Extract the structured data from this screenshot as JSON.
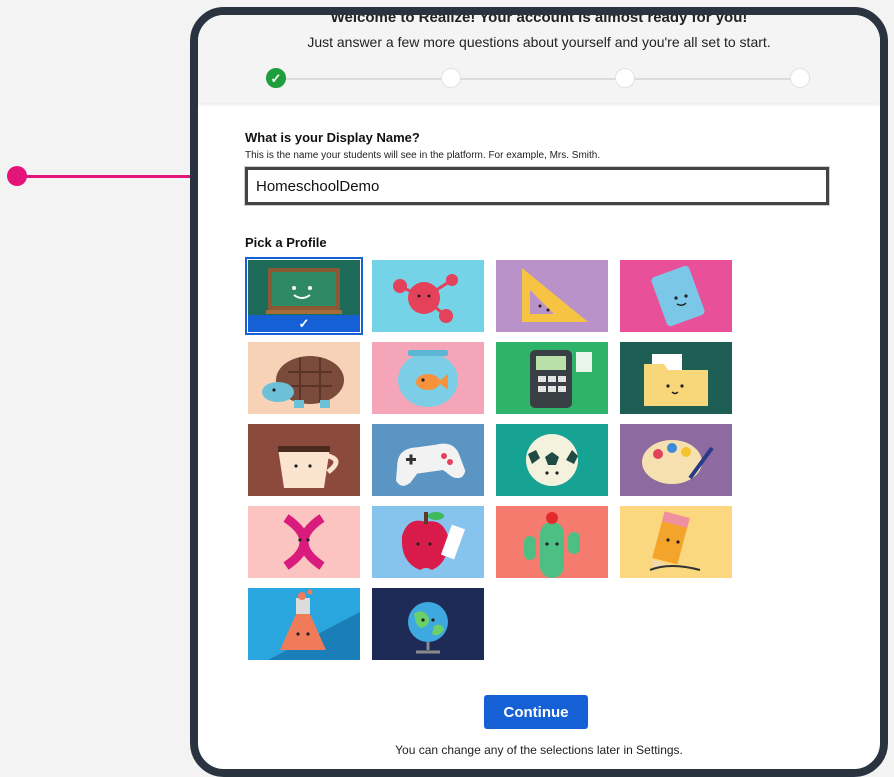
{
  "header": {
    "title": "Welcome to Realize! Your account is almost ready for you!",
    "subtitle": "Just answer a few more questions about yourself and you're all set to start.",
    "steps": [
      {
        "name": "step-1",
        "status": "completed"
      },
      {
        "name": "step-2",
        "status": "pending"
      },
      {
        "name": "step-3",
        "status": "pending"
      },
      {
        "name": "step-4",
        "status": "pending"
      }
    ]
  },
  "display_name": {
    "label": "What is your Display Name?",
    "help": "This is the name your students will see in the platform. For example, Mrs. Smith.",
    "value": "HomeschoolDemo"
  },
  "profile": {
    "label": "Pick a Profile",
    "selected_index": 0,
    "check_mark": "✓",
    "avatars": [
      {
        "id": "chalkboard",
        "bg": "#1e6b5a"
      },
      {
        "id": "molecule",
        "bg": "#74d3e6"
      },
      {
        "id": "ruler-triangle",
        "bg": "#b992c9"
      },
      {
        "id": "notebook",
        "bg": "#e8509a"
      },
      {
        "id": "turtle",
        "bg": "#f7d2b6"
      },
      {
        "id": "fishbowl",
        "bg": "#f4a6b8"
      },
      {
        "id": "calculator",
        "bg": "#2fb36a"
      },
      {
        "id": "folder",
        "bg": "#1f5e55"
      },
      {
        "id": "coffee-cup",
        "bg": "#8b4a3c"
      },
      {
        "id": "game-controller",
        "bg": "#5b95c3"
      },
      {
        "id": "soccer-ball",
        "bg": "#17a394"
      },
      {
        "id": "paint-palette",
        "bg": "#8d6aa0"
      },
      {
        "id": "dna",
        "bg": "#fbc4c0"
      },
      {
        "id": "apple",
        "bg": "#86c4ee"
      },
      {
        "id": "cactus",
        "bg": "#f47b6e"
      },
      {
        "id": "pencil",
        "bg": "#fbd77f"
      },
      {
        "id": "flask",
        "bg": "#2aa6df"
      },
      {
        "id": "globe",
        "bg": "#1e2b56"
      }
    ]
  },
  "actions": {
    "continue_label": "Continue"
  },
  "footer": {
    "note": "You can change any of the selections later in Settings."
  },
  "colors": {
    "accent": "#1660d6",
    "success": "#1e9e3d",
    "pointer": "#e4157a",
    "frame": "#2a3440"
  }
}
